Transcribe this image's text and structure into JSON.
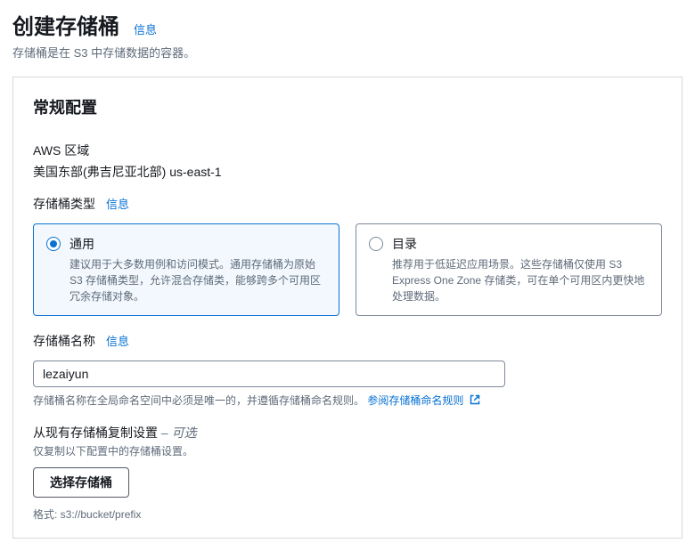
{
  "header": {
    "title": "创建存储桶",
    "info": "信息",
    "subtitle": "存储桶是在 S3 中存储数据的容器。"
  },
  "panel": {
    "title": "常规配置",
    "region": {
      "label": "AWS 区域",
      "value": "美国东部(弗吉尼亚北部) us-east-1"
    },
    "bucket_type": {
      "label": "存储桶类型",
      "info": "信息",
      "options": [
        {
          "title": "通用",
          "desc": "建议用于大多数用例和访问模式。通用存储桶为原始 S3 存储桶类型，允许混合存储类，能够跨多个可用区冗余存储对象。"
        },
        {
          "title": "目录",
          "desc": "推荐用于低延迟应用场景。这些存储桶仅使用 S3 Express One Zone 存储类，可在单个可用区内更快地处理数据。"
        }
      ]
    },
    "bucket_name": {
      "label": "存储桶名称",
      "info": "信息",
      "value": "lezaiyun",
      "helper_text": "存储桶名称在全局命名空间中必须是唯一的，并遵循存储桶命名规则。",
      "helper_link": "参阅存储桶命名规则"
    },
    "copy_settings": {
      "label": "从现有存储桶复制设置",
      "optional": "– 可选",
      "subtitle": "仅复制以下配置中的存储桶设置。",
      "button": "选择存储桶",
      "format": "格式: s3://bucket/prefix"
    }
  }
}
